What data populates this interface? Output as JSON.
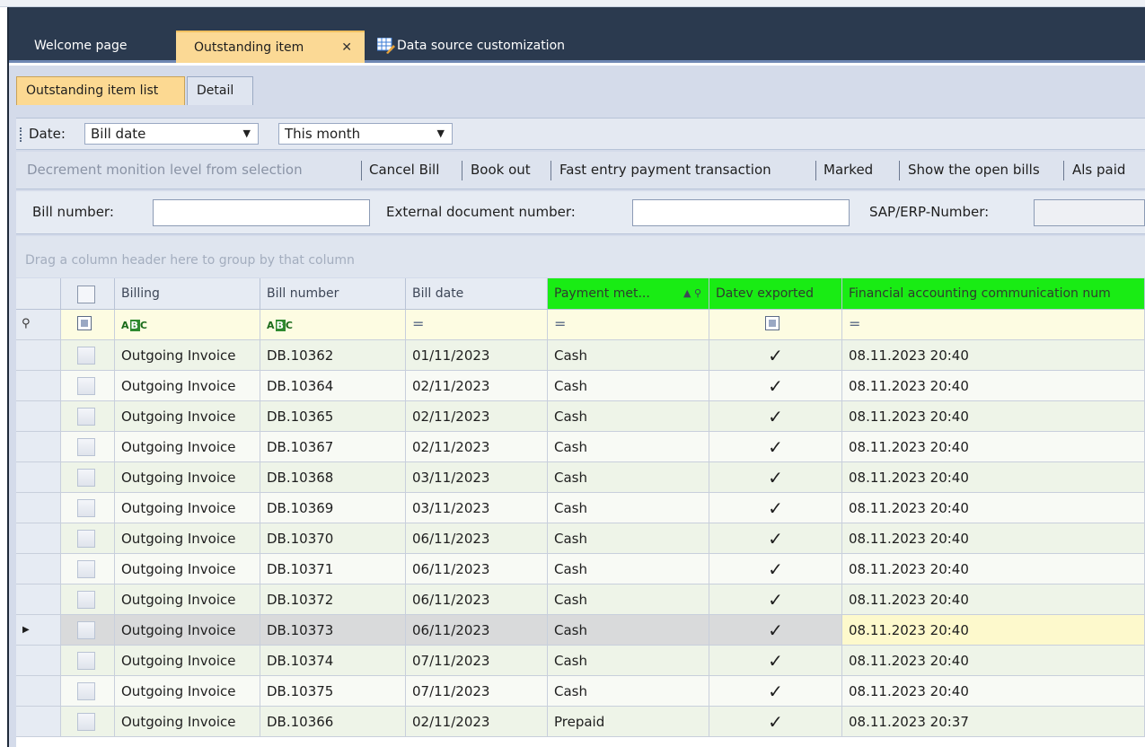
{
  "doc_tabs": {
    "welcome": "Welcome page",
    "outstanding": "Outstanding item",
    "close": "✕",
    "datasource": "Data source customization"
  },
  "sub_tabs": {
    "list": "Outstanding item list",
    "detail": "Detail"
  },
  "filter": {
    "date_label": "Date:",
    "date_field": "Bill date",
    "period": "This month"
  },
  "actions": [
    "Decrement monition level from selection",
    "Cancel Bill",
    "Book out",
    "Fast entry payment transaction",
    "Marked",
    "Show the open bills",
    "Als paid"
  ],
  "search": {
    "bill_number": "Bill number:",
    "external": "External document  number:",
    "sap": "SAP/ERP-Number:"
  },
  "group_hint": "Drag a column header here to group by that column",
  "columns": {
    "billing": "Billing",
    "bill_number": "Bill number",
    "bill_date": "Bill date",
    "payment": "Payment met...",
    "datev": "Datev exported",
    "fin": "Financial accounting communication num"
  },
  "filter_row": {
    "abc": "ABC",
    "eq": "="
  },
  "rows": [
    {
      "billing": "Outgoing Invoice",
      "number": "DB.10362",
      "date": "01/11/2023",
      "payment": "Cash",
      "datev": "✓",
      "fin": "08.11.2023 20:40"
    },
    {
      "billing": "Outgoing Invoice",
      "number": "DB.10364",
      "date": "02/11/2023",
      "payment": "Cash",
      "datev": "✓",
      "fin": "08.11.2023 20:40"
    },
    {
      "billing": "Outgoing Invoice",
      "number": "DB.10365",
      "date": "02/11/2023",
      "payment": "Cash",
      "datev": "✓",
      "fin": "08.11.2023 20:40"
    },
    {
      "billing": "Outgoing Invoice",
      "number": "DB.10367",
      "date": "02/11/2023",
      "payment": "Cash",
      "datev": "✓",
      "fin": "08.11.2023 20:40"
    },
    {
      "billing": "Outgoing Invoice",
      "number": "DB.10368",
      "date": "03/11/2023",
      "payment": "Cash",
      "datev": "✓",
      "fin": "08.11.2023 20:40"
    },
    {
      "billing": "Outgoing Invoice",
      "number": "DB.10369",
      "date": "03/11/2023",
      "payment": "Cash",
      "datev": "✓",
      "fin": "08.11.2023 20:40"
    },
    {
      "billing": "Outgoing Invoice",
      "number": "DB.10370",
      "date": "06/11/2023",
      "payment": "Cash",
      "datev": "✓",
      "fin": "08.11.2023 20:40"
    },
    {
      "billing": "Outgoing Invoice",
      "number": "DB.10371",
      "date": "06/11/2023",
      "payment": "Cash",
      "datev": "✓",
      "fin": "08.11.2023 20:40"
    },
    {
      "billing": "Outgoing Invoice",
      "number": "DB.10372",
      "date": "06/11/2023",
      "payment": "Cash",
      "datev": "✓",
      "fin": "08.11.2023 20:40"
    },
    {
      "billing": "Outgoing Invoice",
      "number": "DB.10373",
      "date": "06/11/2023",
      "payment": "Cash",
      "datev": "✓",
      "fin": "08.11.2023 20:40",
      "selected": true
    },
    {
      "billing": "Outgoing Invoice",
      "number": "DB.10374",
      "date": "07/11/2023",
      "payment": "Cash",
      "datev": "✓",
      "fin": "08.11.2023 20:40"
    },
    {
      "billing": "Outgoing Invoice",
      "number": "DB.10375",
      "date": "07/11/2023",
      "payment": "Cash",
      "datev": "✓",
      "fin": "08.11.2023 20:40"
    },
    {
      "billing": "Outgoing Invoice",
      "number": "DB.10366",
      "date": "02/11/2023",
      "payment": "Prepaid",
      "datev": "✓",
      "fin": "08.11.2023 20:37"
    }
  ],
  "colors": {
    "highlight": "#19ec14",
    "active_tab": "#fbd995",
    "tabbar": "#2b3a4f"
  }
}
